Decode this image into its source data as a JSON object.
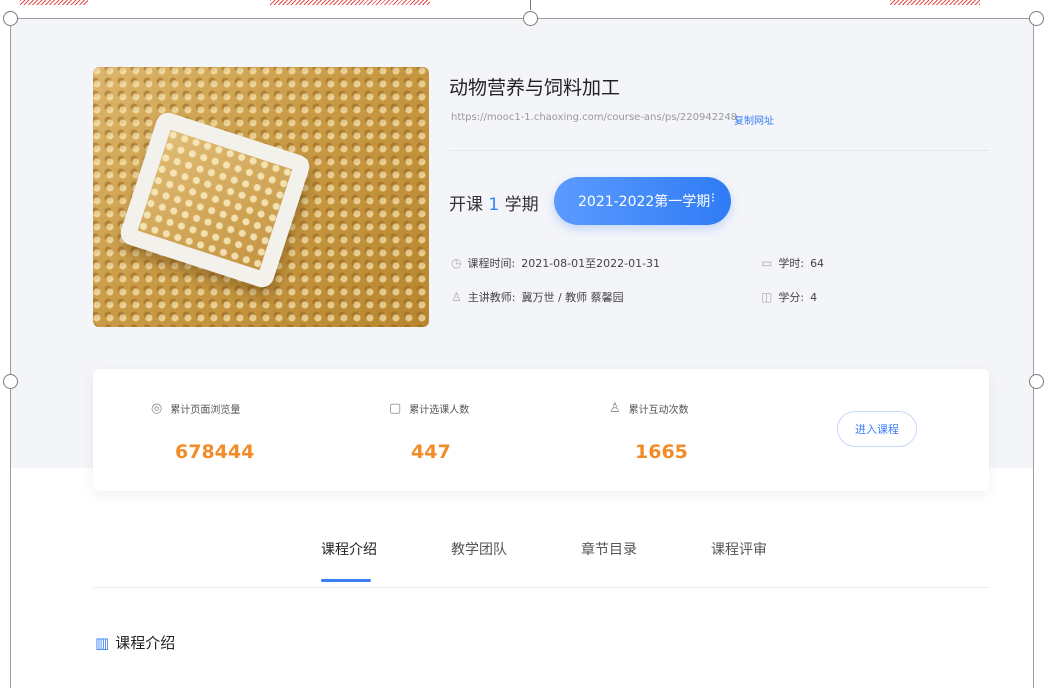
{
  "course": {
    "title": "动物营养与饲料加工",
    "url": "https://mooc1-1.chaoxing.com/course-ans/ps/220942248",
    "copy_link_label": "复制网址"
  },
  "term": {
    "open_prefix": "开课",
    "open_count": "1",
    "open_suffix": "学期",
    "selected": "2021-2022第一学期",
    "dropdown_glyph": "⁝"
  },
  "meta": {
    "time_label": "课程时间:",
    "time_value": "2021-08-01至2022-01-31",
    "teacher_label": "主讲教师:",
    "teacher_value": "冀万世 / 教师 蔡馨园",
    "hours_label": "学时:",
    "hours_value": "64",
    "credit_label": "学分:",
    "credit_value": "4"
  },
  "stats": {
    "page_views_label": "累计页面浏览量",
    "page_views_value": "678444",
    "enrolled_label": "累计选课人数",
    "enrolled_value": "447",
    "interactions_label": "累计互动次数",
    "interactions_value": "1665",
    "enter_button": "进入课程"
  },
  "tabs": [
    {
      "label": "课程介绍",
      "active": true
    },
    {
      "label": "教学团队",
      "active": false
    },
    {
      "label": "章节目录",
      "active": false
    },
    {
      "label": "课程评审",
      "active": false
    }
  ],
  "section": {
    "title": "课程介绍"
  },
  "icons": {
    "clock": "◷",
    "user": "♙",
    "calendar": "▭",
    "credit": "◫",
    "eye": "◎",
    "enroll": "▢",
    "interaction": "♙",
    "building": "▥"
  },
  "colors": {
    "accent": "#3b7ff5",
    "stat_value": "#f28c28",
    "header_bg": "#f4f5f9"
  }
}
